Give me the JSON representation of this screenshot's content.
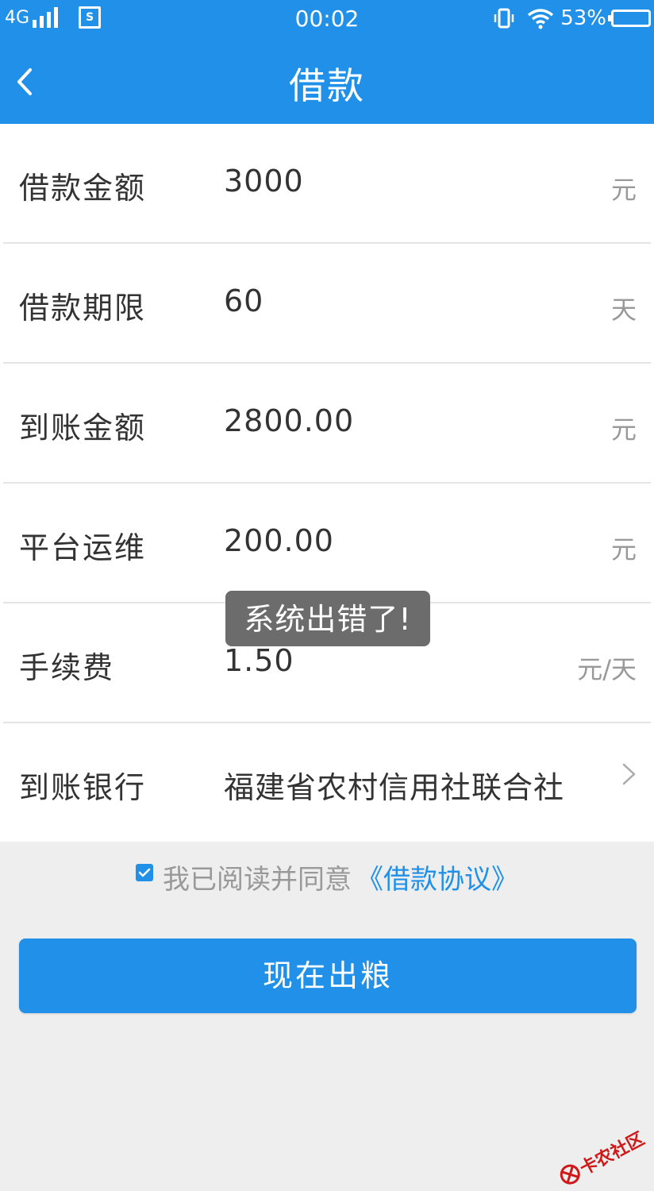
{
  "status_bar": {
    "network": "4G",
    "time": "00:02",
    "battery": "53%"
  },
  "nav": {
    "title": "借款"
  },
  "form": {
    "rows": [
      {
        "label": "借款金额",
        "value": "3000",
        "unit": "元"
      },
      {
        "label": "借款期限",
        "value": "60",
        "unit": "天"
      },
      {
        "label": "到账金额",
        "value": "2800.00",
        "unit": "元"
      },
      {
        "label": "平台运维",
        "value": "200.00",
        "unit": "元"
      },
      {
        "label": "手续费",
        "value": "1.50",
        "unit": "元/天"
      },
      {
        "label": "到账银行",
        "value": "福建省农村信用社联合社",
        "unit": ""
      }
    ]
  },
  "agreement": {
    "checked": true,
    "text": "我已阅读并同意",
    "link": "《借款协议》"
  },
  "submit": {
    "label": "现在出粮"
  },
  "toast": {
    "message": "系统出错了!"
  },
  "watermark": {
    "text": "卡农社区"
  },
  "colors": {
    "accent": "#2090e8",
    "background": "#eeeeee",
    "toast": "#6c6c6c",
    "watermark": "#d01818"
  }
}
